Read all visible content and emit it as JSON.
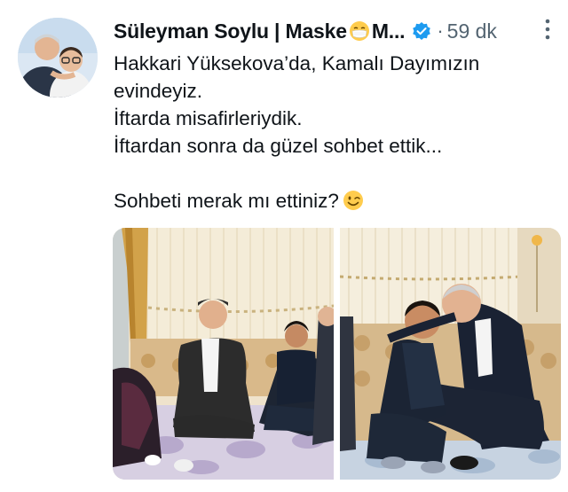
{
  "author": {
    "name": "Süleyman Soylu | Maske",
    "name_suffix": "M...",
    "mask_emoji": "mask-emoji-icon",
    "verified": true,
    "time_separator": "·",
    "time": "59 dk"
  },
  "tweet": {
    "lines": [
      "Hakkari Yüksekova’da, Kamalı Dayımızın",
      "evindeyiz.",
      "İftarda misafirleriydik.",
      "İftardan sonra da güzel sohbet ettik...",
      "Sohbeti merak mı ettiniz?"
    ],
    "trailing_emoji": "winking-face-icon"
  },
  "media": {
    "count": 2,
    "photos": [
      "photo-left",
      "photo-right"
    ]
  },
  "colors": {
    "text": "#0f1419",
    "secondary": "#536471",
    "verified": "#1d9bf0"
  }
}
